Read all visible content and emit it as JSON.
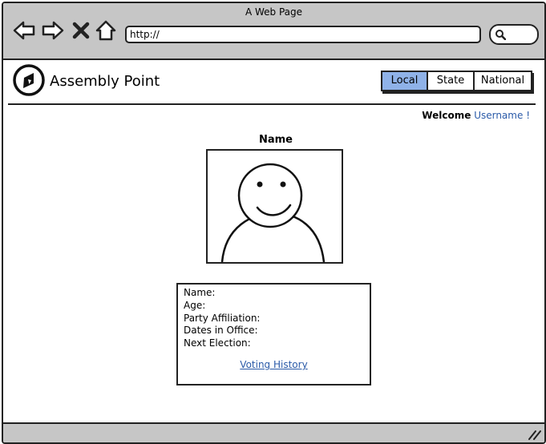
{
  "window": {
    "title": "A Web Page"
  },
  "browser": {
    "url": "http://"
  },
  "header": {
    "app_name": "Assembly Point",
    "tabs": [
      {
        "label": "Local",
        "active": true
      },
      {
        "label": "State",
        "active": false
      },
      {
        "label": "National",
        "active": false
      }
    ]
  },
  "welcome": {
    "prefix": "Welcome",
    "username": "Username",
    "suffix": "!"
  },
  "profile": {
    "heading": "Name",
    "fields": [
      {
        "label": "Name:"
      },
      {
        "label": "Age:"
      },
      {
        "label": "Party Affiliation:"
      },
      {
        "label": "Dates in Office:"
      },
      {
        "label": "Next Election:"
      }
    ],
    "link": "Voting History"
  },
  "colors": {
    "accent": "#8fb2e8",
    "link": "#2a5aa8",
    "chrome": "#c6c6c6"
  }
}
